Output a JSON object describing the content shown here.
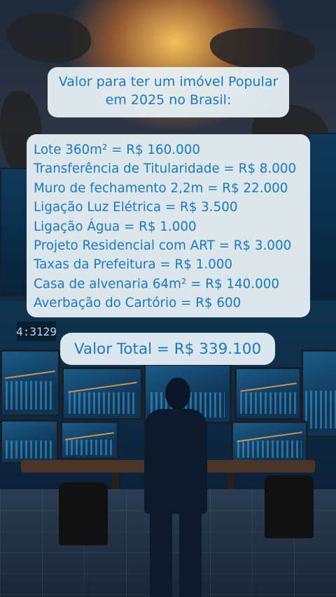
{
  "title": "Valor para ter um imóvel Popular em 2025 no Brasil:",
  "items": [
    "Lote 360m² = R$ 160.000",
    "Transferência de Titularidade = R$ 8.000",
    "Muro de fechamento 2,2m = R$ 22.000",
    "Ligação Luz Elétrica = R$ 3.500",
    "Ligação Água = R$ 1.000",
    "Projeto Residencial com ART = R$ 3.000",
    "Taxas da Prefeitura = R$ 1.000",
    "Casa de alvenaria 64m² = R$ 140.000",
    "Averbação do Cartório = R$ 600"
  ],
  "total": "Valor Total = R$ 339.100",
  "background": {
    "ticker": "4:3129",
    "colors": {
      "card": "#e8f2f6",
      "text": "#1a78c4",
      "glow": "#ffc85a"
    }
  }
}
